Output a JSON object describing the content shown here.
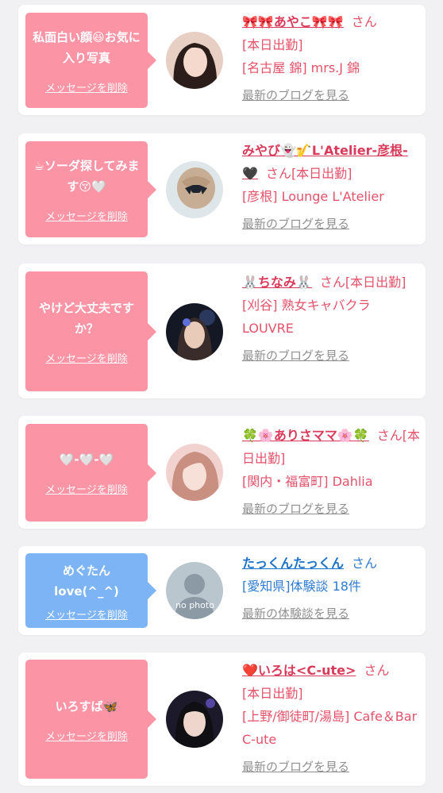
{
  "entries": [
    {
      "message": "私面白い顔😆お気に入り写真",
      "delete_label": "メッセージを削除",
      "name": "🎀🎀あやこ🎀🎀",
      "san": "さん",
      "lines": [
        "[本日出勤]",
        "[名古屋 錦] mrs.J 錦"
      ],
      "link": "最新のブログを見る",
      "bubble_color": "#fb95a5",
      "avatar": "girl-photo-1"
    },
    {
      "message": "☕ソーダ探してみます😚🤍",
      "delete_label": "メッセージを削除",
      "name": "みやび👻🎷L'Atelier-彦根-🖤",
      "san": "さん",
      "lines": [
        "[本日出勤]",
        "[彦根] Lounge L'Atelier"
      ],
      "link": "最新のブログを見る",
      "bubble_color": "#fb95a5",
      "avatar": "girl-photo-2"
    },
    {
      "message": "やけど大丈夫ですか？",
      "delete_label": "メッセージを削除",
      "name": "🐰ちなみ🐰",
      "san": "さん",
      "lines": [
        "[本日出勤]",
        "[刈谷] 熟女キャバクラLOUVRE"
      ],
      "link": "最新のブログを見る",
      "bubble_color": "#fb95a5",
      "avatar": "girl-photo-3"
    },
    {
      "message": "🤍-🤍-🤍",
      "delete_label": "メッセージを削除",
      "name": "🍀🌸ありさママ🌸🍀",
      "san": "さん",
      "lines": [
        "[本日出勤]",
        "[関内・福富町] Dahlia"
      ],
      "link": "最新のブログを見る",
      "bubble_color": "#fb95a5",
      "avatar": "girl-photo-4"
    },
    {
      "message": "めぐたんlove(^_^)",
      "delete_label": "メッセージを削除",
      "name": "たっくんたっくん",
      "san": "さん",
      "lines": [
        "[愛知県]体験談 18件"
      ],
      "link": "最新の体験談を見る",
      "bubble_color": "#7db4f5",
      "avatar": "no-photo",
      "avatar_text": "no photo"
    },
    {
      "message": "いろすば🦋",
      "delete_label": "メッセージを削除",
      "name": "❤️いろは<C-ute>",
      "san": "さん",
      "lines": [
        "[本日出勤]",
        "[上野/御徒町/湯島] Cafe＆Bar C-ute"
      ],
      "link": "最新のブログを見る",
      "bubble_color": "#fb95a5",
      "avatar": "girl-photo-6"
    }
  ]
}
